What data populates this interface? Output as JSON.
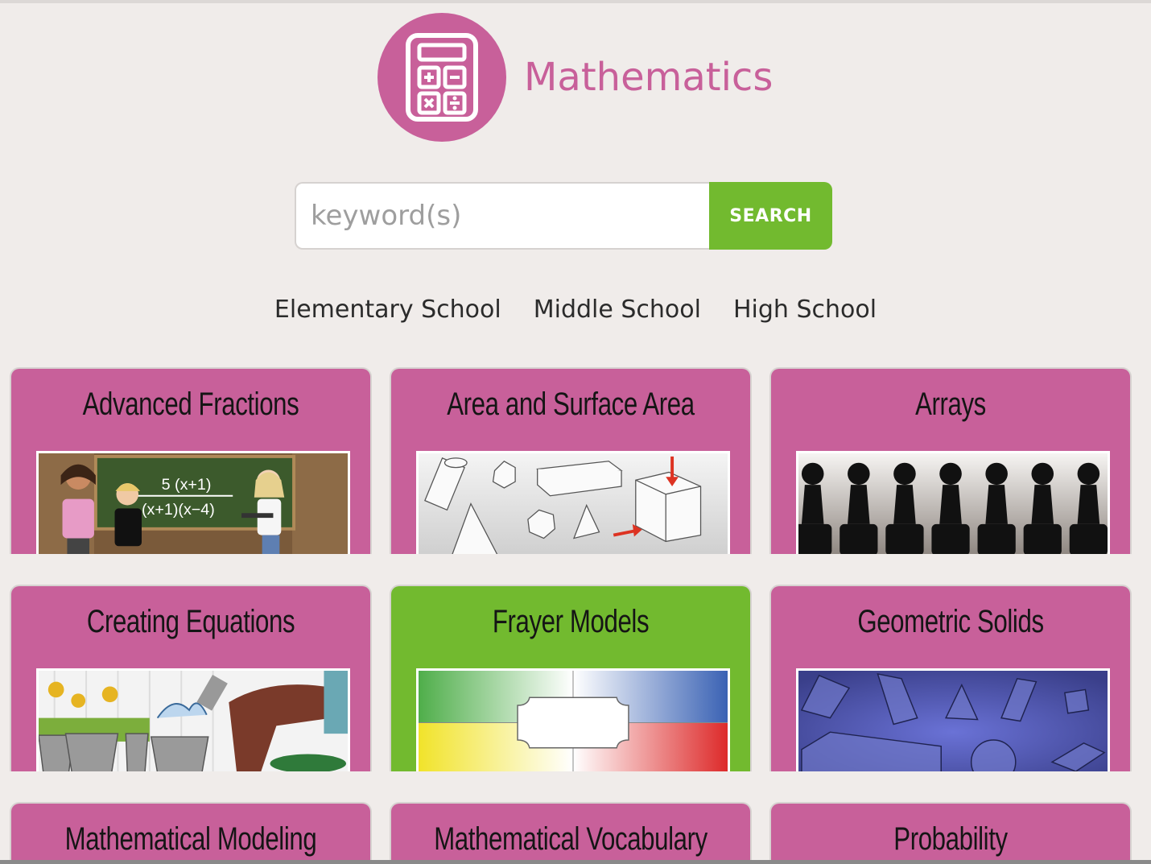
{
  "header": {
    "title": "Mathematics",
    "logo_icon": "calculator-icon"
  },
  "search": {
    "placeholder": "keyword(s)",
    "button_label": "SEARCH"
  },
  "levels": [
    "Elementary School",
    "Middle School",
    "High School"
  ],
  "colors": {
    "brand_pink": "#c8609a",
    "accent_green": "#72ba2f",
    "background": "#f0ecea"
  },
  "cards": [
    {
      "title": "Advanced Fractions",
      "image": "classroom-fraction-illustration"
    },
    {
      "title": "Area and Surface Area",
      "image": "geometric-shapes-sketch"
    },
    {
      "title": "Arrays",
      "image": "chess-pawns-row"
    },
    {
      "title": "Creating Equations",
      "image": "garden-buckets-illustration"
    },
    {
      "title": "Frayer Models",
      "image": "frayer-model-diagram"
    },
    {
      "title": "Geometric Solids",
      "image": "geometric-solids-blue"
    },
    {
      "title": "Mathematical Modeling",
      "image": ""
    },
    {
      "title": "Mathematical Vocabulary",
      "image": ""
    },
    {
      "title": "Probability",
      "image": ""
    }
  ]
}
